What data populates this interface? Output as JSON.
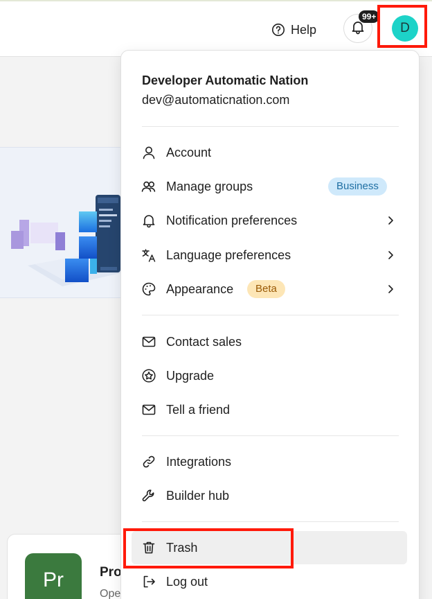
{
  "header": {
    "help_label": "Help",
    "notification_count": "99+",
    "avatar_initial": "D"
  },
  "menu": {
    "user_name": "Developer Automatic Nation",
    "user_email": "dev@automaticnation.com",
    "items": {
      "account": "Account",
      "manage_groups": "Manage groups",
      "manage_groups_badge": "Business",
      "notification_prefs": "Notification preferences",
      "language_prefs": "Language preferences",
      "appearance": "Appearance",
      "appearance_badge": "Beta",
      "contact_sales": "Contact sales",
      "upgrade": "Upgrade",
      "tell_friend": "Tell a friend",
      "integrations": "Integrations",
      "builder_hub": "Builder hub",
      "trash": "Trash",
      "log_out": "Log out"
    }
  },
  "background": {
    "app_icon_text": "Pr",
    "card_title": "Pro",
    "card_subtitle": "Ope"
  },
  "colors": {
    "avatar": "#1dd3c8",
    "highlight": "#ff1a0a",
    "business_badge": "#cfe9fb",
    "beta_badge": "#fde6b6"
  }
}
